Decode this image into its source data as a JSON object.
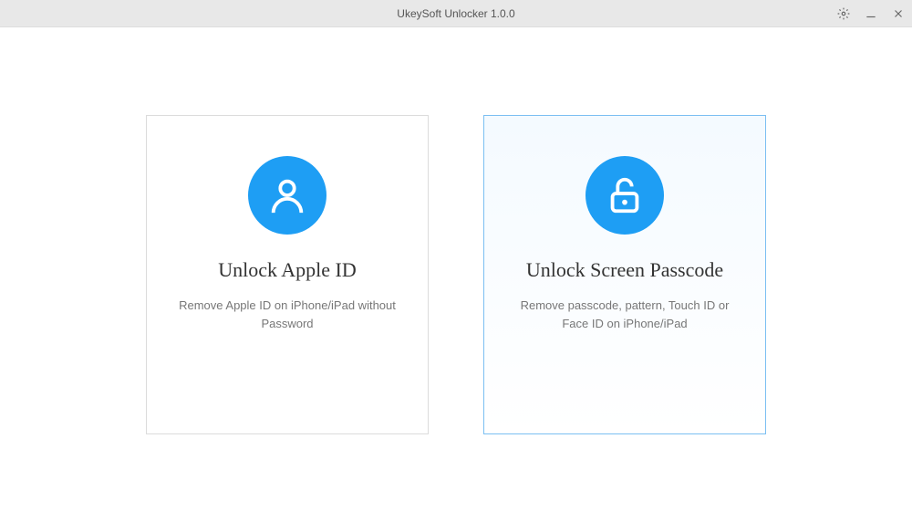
{
  "titlebar": {
    "title": "UkeySoft Unlocker 1.0.0"
  },
  "cards": {
    "appleId": {
      "title": "Unlock Apple ID",
      "description": "Remove Apple ID on iPhone/iPad without Password"
    },
    "screenPasscode": {
      "title": "Unlock Screen Passcode",
      "description": "Remove passcode, pattern, Touch ID or Face ID on iPhone/iPad"
    }
  }
}
